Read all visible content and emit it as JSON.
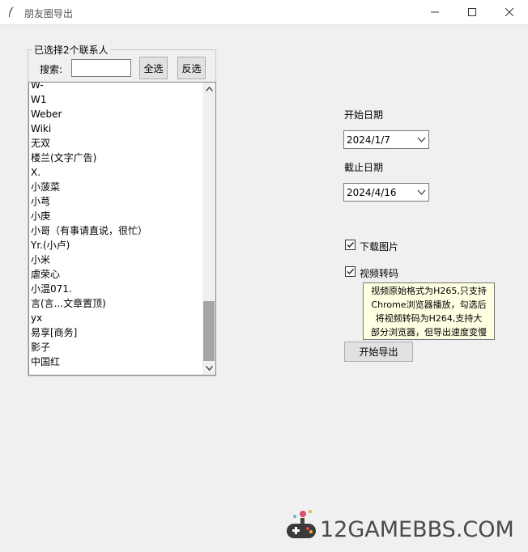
{
  "window": {
    "title": "朋友圈导出"
  },
  "contacts_group": {
    "label": "已选择2个联系人",
    "search_label": "搜索:",
    "search_value": "",
    "select_all_label": "全选",
    "invert_label": "反选",
    "items": [
      "W-",
      "W1",
      "Weber",
      "Wiki",
      "无双",
      "楼兰(文字广告)",
      "X.",
      "小菠菜",
      "小芎",
      "小庚",
      "小哥（有事请直说，很忙）",
      "Yr.(小卢)",
      "小米",
      "虐荣心",
      "小温071.",
      "言(言...文章置顶)",
      "yx",
      "易享[商务]",
      "影子",
      "中国红"
    ]
  },
  "dates": {
    "start_label": "开始日期",
    "start_value": "2024/1/7",
    "end_label": "截止日期",
    "end_value": "2024/4/16"
  },
  "options": {
    "download_images_label": "下载图片",
    "download_images_checked": true,
    "video_transcode_label": "视频转码",
    "video_transcode_checked": true,
    "tooltip_lines": [
      "视频原始格式为H265,只支持",
      "Chrome浏览器播放，勾选后",
      "将视频转码为H264,支持大",
      "部分浏览器，但导出速度变慢"
    ]
  },
  "export_button_label": "开始导出",
  "watermark": {
    "text": "12GAMEBBS.COM"
  }
}
